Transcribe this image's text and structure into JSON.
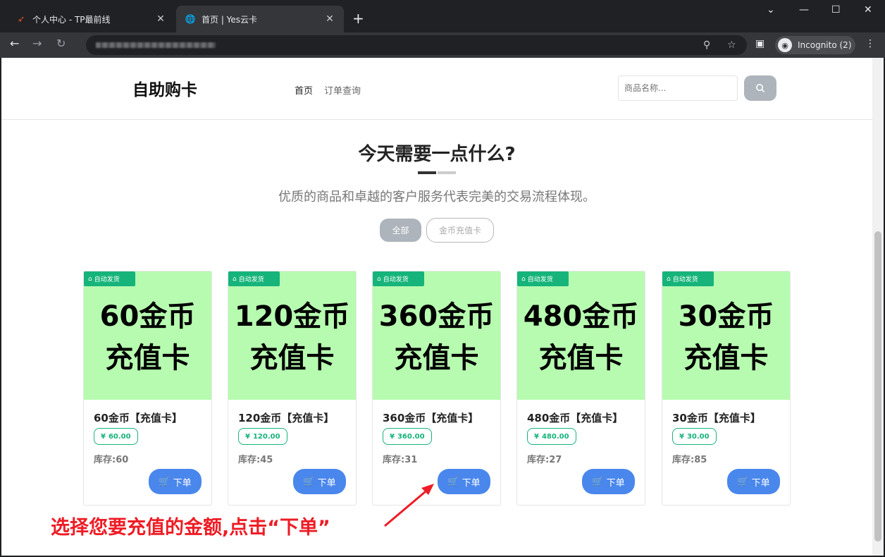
{
  "browser": {
    "tabs": [
      {
        "title": "个人中心 - TP最前线",
        "active": false
      },
      {
        "title": "首页 | Yes云卡",
        "active": true
      }
    ],
    "incognito_label": "Incognito (2)"
  },
  "header": {
    "brand": "自助购卡",
    "nav": [
      {
        "label": "首页",
        "active": true
      },
      {
        "label": "订单查询",
        "active": false
      }
    ],
    "search_placeholder": "商品名称..."
  },
  "hero": {
    "title": "今天需要一点什么?",
    "subtitle": "优质的商品和卓越的客户服务代表完美的交易流程体现。"
  },
  "filters": [
    {
      "label": "全部",
      "active": true
    },
    {
      "label": "金币充值卡",
      "active": false
    }
  ],
  "products": [
    {
      "badge": "自动发货",
      "img_line1": "60金币",
      "img_line2": "充值卡",
      "name": "60金币【充值卡】",
      "price": "60.00",
      "stock_label": "库存:",
      "stock": "60",
      "buy_label": "下单"
    },
    {
      "badge": "自动发货",
      "img_line1": "120金币",
      "img_line2": "充值卡",
      "name": "120金币【充值卡】",
      "price": "120.00",
      "stock_label": "库存:",
      "stock": "45",
      "buy_label": "下单"
    },
    {
      "badge": "自动发货",
      "img_line1": "360金币",
      "img_line2": "充值卡",
      "name": "360金币【充值卡】",
      "price": "360.00",
      "stock_label": "库存:",
      "stock": "31",
      "buy_label": "下单"
    },
    {
      "badge": "自动发货",
      "img_line1": "480金币",
      "img_line2": "充值卡",
      "name": "480金币【充值卡】",
      "price": "480.00",
      "stock_label": "库存:",
      "stock": "27",
      "buy_label": "下单"
    },
    {
      "badge": "自动发货",
      "img_line1": "30金币",
      "img_line2": "充值卡",
      "name": "30金币【充值卡】",
      "price": "30.00",
      "stock_label": "库存:",
      "stock": "85",
      "buy_label": "下单"
    }
  ],
  "annotation": "选择您要充值的金额,点击“下单”",
  "colors": {
    "accent_green": "#16b47a",
    "buy_blue": "#4a87ec",
    "card_bg": "#b7fbb0",
    "annotation_red": "#ee1c25"
  }
}
